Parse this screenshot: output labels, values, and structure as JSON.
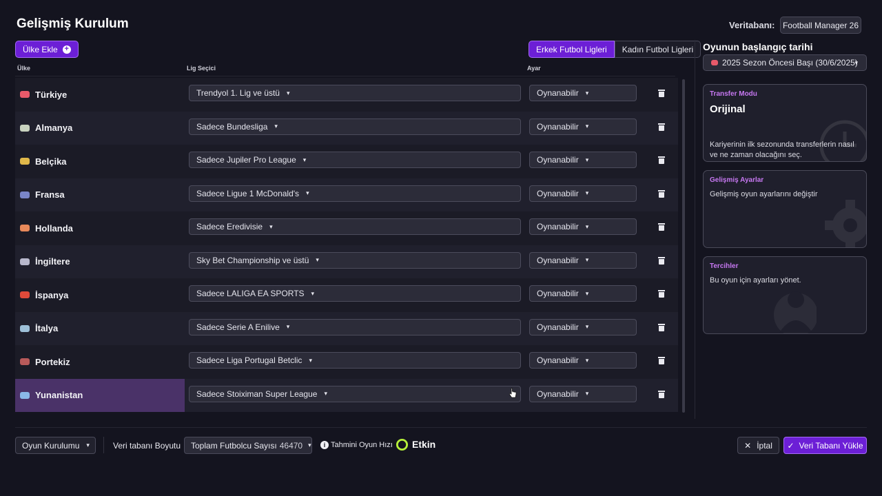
{
  "header": {
    "title": "Gelişmiş Kurulum",
    "database_label": "Veritabanı:",
    "database_value": "Football Manager 26"
  },
  "toolbar": {
    "add_country_label": "Ülke Ekle",
    "add_icon": "plus-circle-icon",
    "tabs": [
      {
        "label": "Erkek Futbol Ligleri",
        "active": true
      },
      {
        "label": "Kadın Futbol Ligleri",
        "active": false
      }
    ]
  },
  "table": {
    "columns": [
      "Ülke",
      "Lig Seçici",
      "Ayar"
    ],
    "rows": [
      {
        "country": "Türkiye",
        "league": "Trendyol 1. Lig ve üstü",
        "setting": "Oynanabilir",
        "flag_color": "#e85a6a"
      },
      {
        "country": "Almanya",
        "league": "Sadece Bundesliga",
        "setting": "Oynanabilir",
        "flag_color": "#c9d3c0"
      },
      {
        "country": "Belçika",
        "league": "Sadece Jupiler Pro League",
        "setting": "Oynanabilir",
        "flag_color": "#e0b84a"
      },
      {
        "country": "Fransa",
        "league": "Sadece Ligue 1 McDonald's",
        "setting": "Oynanabilir",
        "flag_color": "#7a86c8"
      },
      {
        "country": "Hollanda",
        "league": "Sadece Eredivisie",
        "setting": "Oynanabilir",
        "flag_color": "#e8895a"
      },
      {
        "country": "İngiltere",
        "league": "Sky Bet Championship ve üstü",
        "setting": "Oynanabilir",
        "flag_color": "#b8b8cc"
      },
      {
        "country": "İspanya",
        "league": "Sadece LALIGA EA SPORTS",
        "setting": "Oynanabilir",
        "flag_color": "#e04a3a"
      },
      {
        "country": "İtalya",
        "league": "Sadece Serie A Enilive",
        "setting": "Oynanabilir",
        "flag_color": "#9ec0d8"
      },
      {
        "country": "Portekiz",
        "league": "Sadece Liga Portugal Betclic",
        "setting": "Oynanabilir",
        "flag_color": "#b85a5a"
      },
      {
        "country": "Yunanistan",
        "league": "Sadece Stoiximan Super League",
        "setting": "Oynanabilir",
        "flag_color": "#8ab8e8"
      }
    ]
  },
  "sidebar": {
    "start_date_label": "Oyunun başlangıç tarihi",
    "start_date_value": "2025 Sezon Öncesi Başı (30/6/2025)",
    "cards": [
      {
        "kicker": "Transfer Modu",
        "title": "Orijinal",
        "desc": "Kariyerinin ilk sezonunda transferlerin nasıl ve ne zaman olacağını seç.",
        "icon": "clock-icon"
      },
      {
        "kicker": "Gelişmiş Ayarlar",
        "title": "",
        "desc": "Gelişmiş oyun ayarlarını değiştir",
        "icon": "gear-icon"
      },
      {
        "kicker": "Tercihler",
        "title": "",
        "desc": "Bu oyun için ayarları yönet.",
        "icon": "user-icon"
      }
    ]
  },
  "footer": {
    "game_setup_label": "Oyun Kurulumu",
    "db_size_label": "Veri tabanı Boyutu",
    "players_label": "Toplam Futbolcu Sayısı",
    "players_count": "46470",
    "speed_label": "Tahmini Oyun Hızı",
    "speed_value": "Etkin",
    "cancel_label": "İptal",
    "load_label": "Veri Tabanı Yükle"
  },
  "colors": {
    "accent": "#6c1fd6",
    "accent_border": "#a56cf5",
    "card_kicker": "#c778f2",
    "selected_row": "#4a3268",
    "speed_ring": "#b6f03a"
  }
}
